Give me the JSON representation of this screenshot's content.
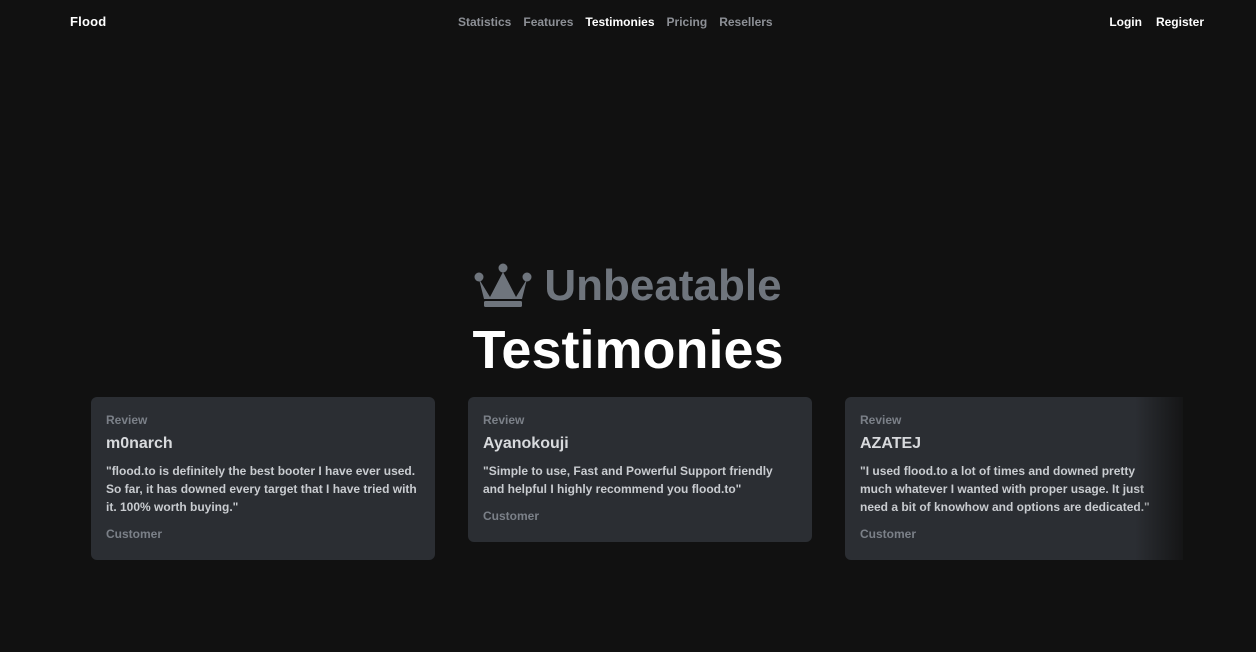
{
  "navbar": {
    "brand": "Flood",
    "links": [
      {
        "label": "Statistics",
        "active": false
      },
      {
        "label": "Features",
        "active": false
      },
      {
        "label": "Testimonies",
        "active": true
      },
      {
        "label": "Pricing",
        "active": false
      },
      {
        "label": "Resellers",
        "active": false
      }
    ],
    "login": "Login",
    "register": "Register"
  },
  "headline": {
    "icon": "crown-icon",
    "eyebrow": "Unbeatable",
    "title": "Testimonies"
  },
  "testimonials": [
    {
      "label": "Review",
      "name": "m0narch",
      "quote": "\"flood.to is definitely the best booter I have ever used. So far, it has downed every target that I have tried with it. 100% worth buying.\"",
      "role": "Customer"
    },
    {
      "label": "Review",
      "name": "Ayanokouji",
      "quote": "\"Simple to use, Fast and Powerful Support friendly and helpful I highly recommend you flood.to\"",
      "role": "Customer"
    },
    {
      "label": "Review",
      "name": "AZATEJ",
      "quote": "\"I used flood.to a lot of times and downed pretty much whatever I wanted with proper usage. It just need a bit of knowhow and options are dedicated.\"",
      "role": "Customer"
    }
  ],
  "colors": {
    "background": "#111111",
    "card": "#2b2e33",
    "muted": "#7b8088",
    "eyebrow": "#6f757d"
  }
}
